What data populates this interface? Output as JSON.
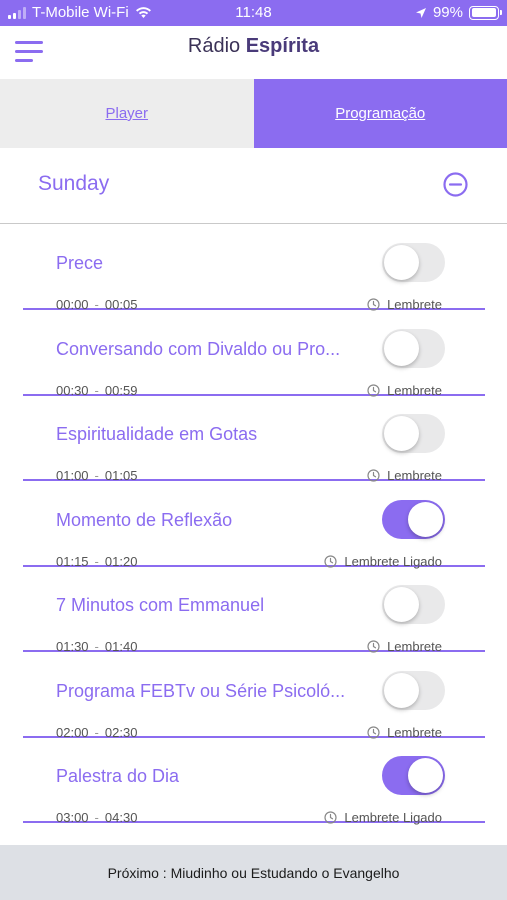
{
  "status": {
    "carrier": "T-Mobile Wi-Fi",
    "time": "11:48",
    "battery": "99%"
  },
  "header": {
    "title_part1": "Rádio ",
    "title_part2": "Espírita"
  },
  "tabs": [
    {
      "label": "Player",
      "active": false
    },
    {
      "label": "Programação",
      "active": true
    }
  ],
  "day": {
    "label": "Sunday"
  },
  "programs": [
    {
      "title": "Prece",
      "start": "00:00",
      "end": "00:05",
      "reminder": "Lembrete",
      "on": false
    },
    {
      "title": "Conversando com Divaldo ou Pro...",
      "start": "00:30",
      "end": "00:59",
      "reminder": "Lembrete",
      "on": false
    },
    {
      "title": "Espiritualidade em Gotas",
      "start": "01:00",
      "end": "01:05",
      "reminder": "Lembrete",
      "on": false
    },
    {
      "title": "Momento de Reflexão",
      "start": "01:15",
      "end": "01:20",
      "reminder": "Lembrete Ligado",
      "on": true
    },
    {
      "title": "7 Minutos com Emmanuel",
      "start": "01:30",
      "end": "01:40",
      "reminder": "Lembrete",
      "on": false
    },
    {
      "title": "Programa FEBTv ou Série Psicoló...",
      "start": "02:00",
      "end": "02:30",
      "reminder": "Lembrete",
      "on": false
    },
    {
      "title": "Palestra do Dia",
      "start": "03:00",
      "end": "04:30",
      "reminder": "Lembrete Ligado",
      "on": true
    }
  ],
  "footer": {
    "text": "Próximo : Miudinho ou Estudando o Evangelho"
  },
  "colors": {
    "accent": "#8b6cf0",
    "toggle_off": "#e9e9ea",
    "footer_bg": "#dde0e5"
  }
}
